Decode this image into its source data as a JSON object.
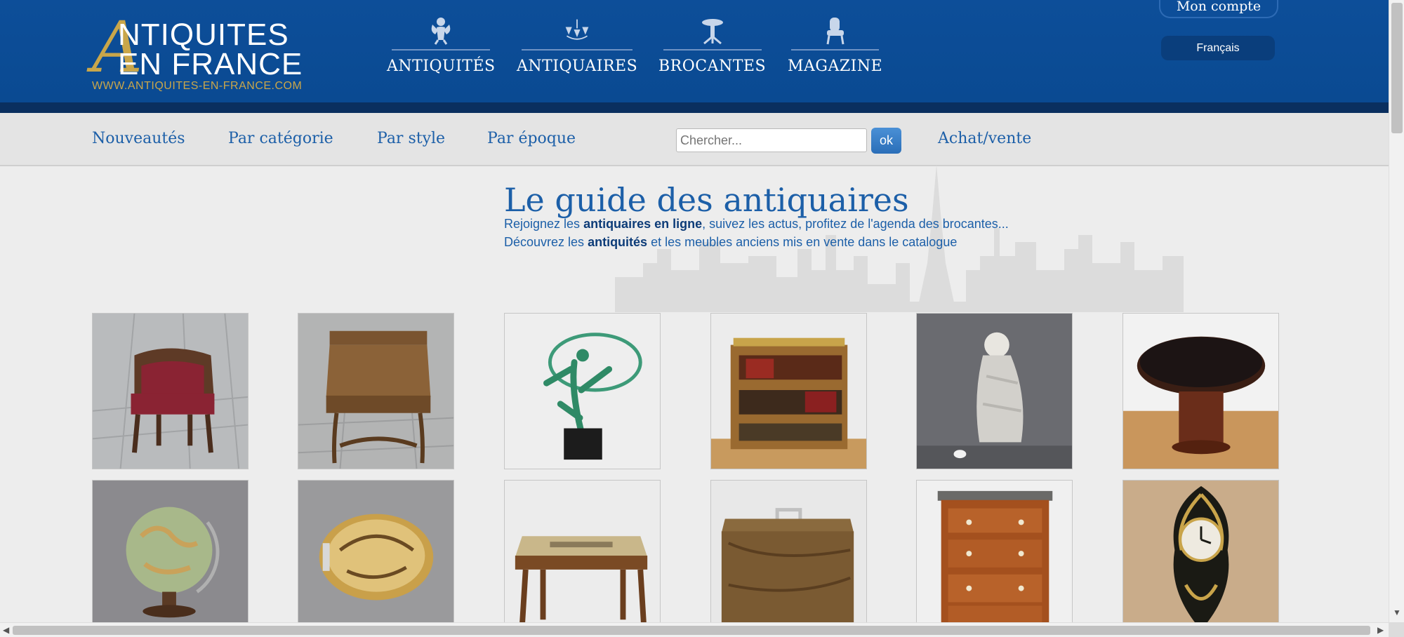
{
  "header": {
    "logo": {
      "line1": "NTIQUITES",
      "line2": "EN FRANCE",
      "letter": "A",
      "url": "WWW.ANTIQUITES-EN-FRANCE.COM"
    },
    "nav": [
      {
        "label": "ANTIQUITÉS",
        "icon": "cherub-icon"
      },
      {
        "label": "ANTIQUAIRES",
        "icon": "chandelier-icon"
      },
      {
        "label": "BROCANTES",
        "icon": "pedestal-table-icon"
      },
      {
        "label": "MAGAZINE",
        "icon": "chair-icon"
      }
    ],
    "account": "Mon compte",
    "language": "Français"
  },
  "subnav": {
    "links": [
      "Nouveautés",
      "Par catégorie",
      "Par style",
      "Par époque"
    ],
    "search_placeholder": "Chercher...",
    "ok_label": "ok",
    "buy_sell": "Achat/vente"
  },
  "main": {
    "title": "Le guide des antiquaires",
    "intro1": {
      "a": "Rejoignez les ",
      "b": "antiquaires en ligne",
      "c": ", suivez les actus, profitez de l'agenda des brocantes..."
    },
    "intro2": {
      "a": "Découvrez les ",
      "b": "antiquités",
      "c": " et les meubles anciens mis en vente dans le catalogue"
    }
  },
  "colors": {
    "header_blue": "#0d4e99",
    "gold": "#c9a64a",
    "link_blue": "#1c5fa8"
  }
}
